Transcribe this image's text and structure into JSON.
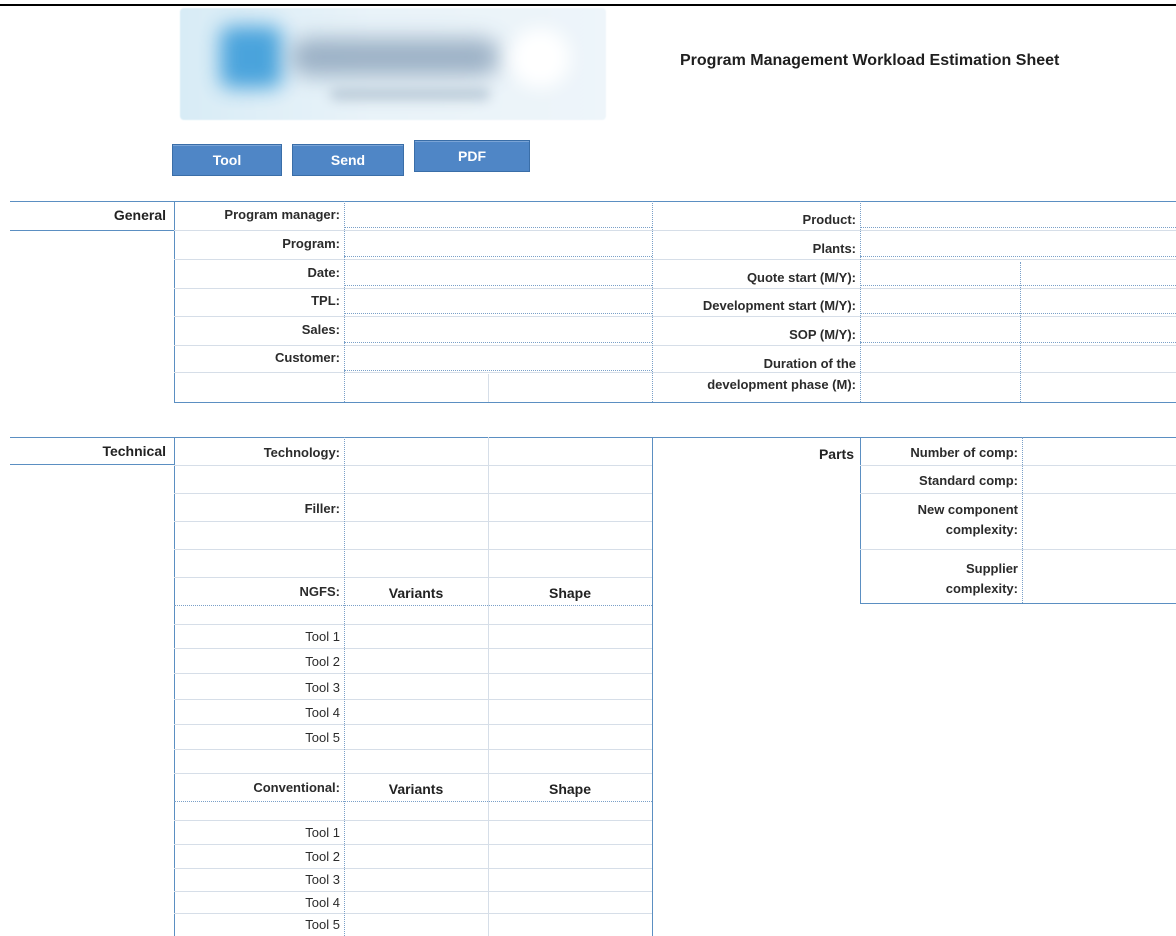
{
  "title": "Program Management Workload Estimation Sheet",
  "buttons": {
    "tool": "Tool",
    "send": "Send",
    "pdf": "PDF"
  },
  "general": {
    "section": "General",
    "left_labels": [
      "Program manager:",
      "Program:",
      "Date:",
      "TPL:",
      "Sales:",
      "Customer:"
    ],
    "right_labels": [
      "Product:",
      "Plants:",
      "Quote start (M/Y):",
      "Development start (M/Y):",
      "SOP (M/Y):",
      "Duration of the",
      "development phase (M):"
    ]
  },
  "technical": {
    "section": "Technical",
    "technology": "Technology:",
    "filler": "Filler:",
    "ngfs": "NGFS:",
    "conventional": "Conventional:",
    "variants": "Variants",
    "shape": "Shape",
    "tools": [
      "Tool 1",
      "Tool 2",
      "Tool 3",
      "Tool 4",
      "Tool 5"
    ]
  },
  "parts": {
    "section": "Parts",
    "labels": [
      "Number of comp:",
      "Standard comp:",
      "New component",
      "complexity:",
      "Supplier",
      "complexity:"
    ]
  },
  "colors": {
    "button": "#4f86c6",
    "border": "#5b8fc2"
  }
}
